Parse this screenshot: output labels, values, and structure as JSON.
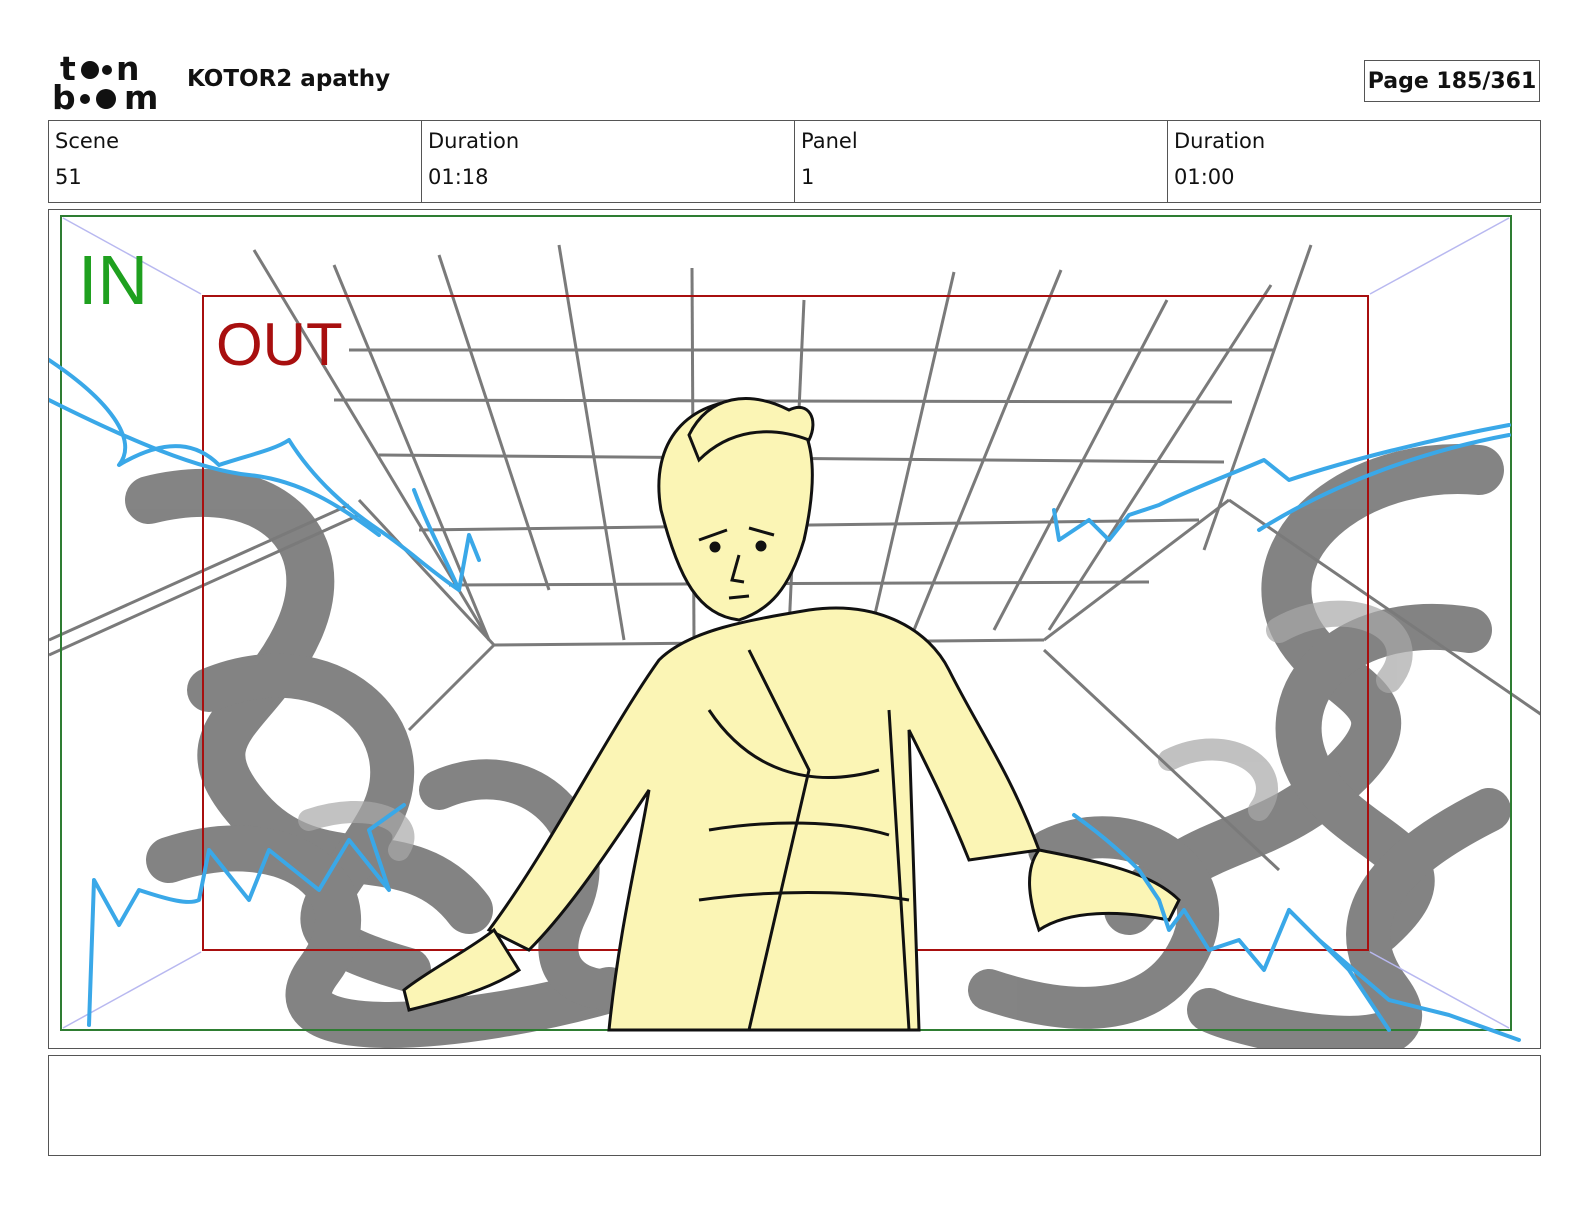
{
  "header": {
    "logo_text": "toon boom",
    "project_title": "KOTOR2 apathy",
    "page_label": "Page 185/361"
  },
  "info": {
    "scene_label": "Scene",
    "scene_value": "51",
    "scene_duration_label": "Duration",
    "scene_duration_value": "01:18",
    "panel_label": "Panel",
    "panel_value": "1",
    "panel_duration_label": "Duration",
    "panel_duration_value": "01:00"
  },
  "panel": {
    "in_label": "IN",
    "out_label": "OUT",
    "in_frame_color": "#2e7d32",
    "out_frame_color": "#a80f0f",
    "energy_color": "#3aa8e8",
    "smoke_color": "#6e6e6e",
    "character_fill": "#fbf5b5"
  },
  "caption": {
    "text": ""
  }
}
